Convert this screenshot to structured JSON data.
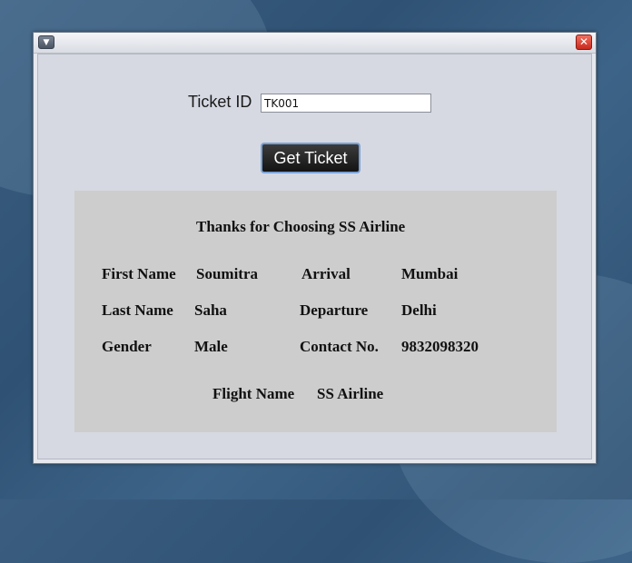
{
  "window": {
    "menu_icon": "chevron-down-icon",
    "close_icon": "close-icon"
  },
  "form": {
    "ticket_label": "Ticket ID",
    "ticket_value": "TK001",
    "get_ticket_label": "Get Ticket"
  },
  "ticket": {
    "heading": "Thanks for Choosing SS Airline",
    "first_name_label": "First Name",
    "first_name_value": "Soumitra",
    "arrival_label": "Arrival",
    "arrival_value": "Mumbai",
    "last_name_label": "Last Name",
    "last_name_value": "Saha",
    "departure_label": "Departure",
    "departure_value": "Delhi",
    "gender_label": "Gender",
    "gender_value": "Male",
    "contact_label": "Contact No.",
    "contact_value": "9832098320",
    "flight_name_label": "Flight Name",
    "flight_name_value": "SS Airline"
  },
  "colors": {
    "panel": "#cdcdcd",
    "button": "#1f1f1f",
    "button_border": "#7aa2d6",
    "close": "#d83a2c"
  }
}
